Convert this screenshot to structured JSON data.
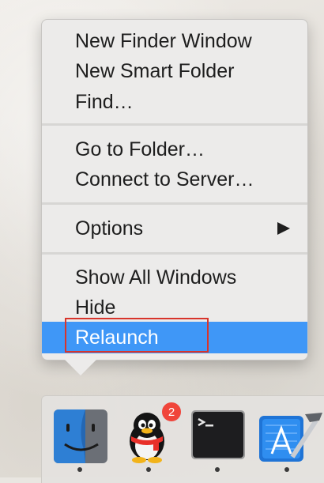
{
  "menu": {
    "items": [
      {
        "label": "New Finder Window"
      },
      {
        "label": "New Smart Folder"
      },
      {
        "label": "Find…"
      },
      {
        "label": "Go to Folder…"
      },
      {
        "label": "Connect to Server…"
      },
      {
        "label": "Options"
      },
      {
        "label": "Show All Windows"
      },
      {
        "label": "Hide"
      },
      {
        "label": "Relaunch",
        "selected": true
      }
    ]
  },
  "dock": {
    "apps": [
      {
        "name": "finder-icon",
        "running": true
      },
      {
        "name": "qq-penguin-icon",
        "badge": "2",
        "running": true
      },
      {
        "name": "terminal-icon",
        "running": true
      },
      {
        "name": "xcode-icon",
        "running": true
      }
    ]
  },
  "colors": {
    "selection": "#3f97f7",
    "annotation_box": "#d8342b",
    "badge": "#f0453a"
  }
}
